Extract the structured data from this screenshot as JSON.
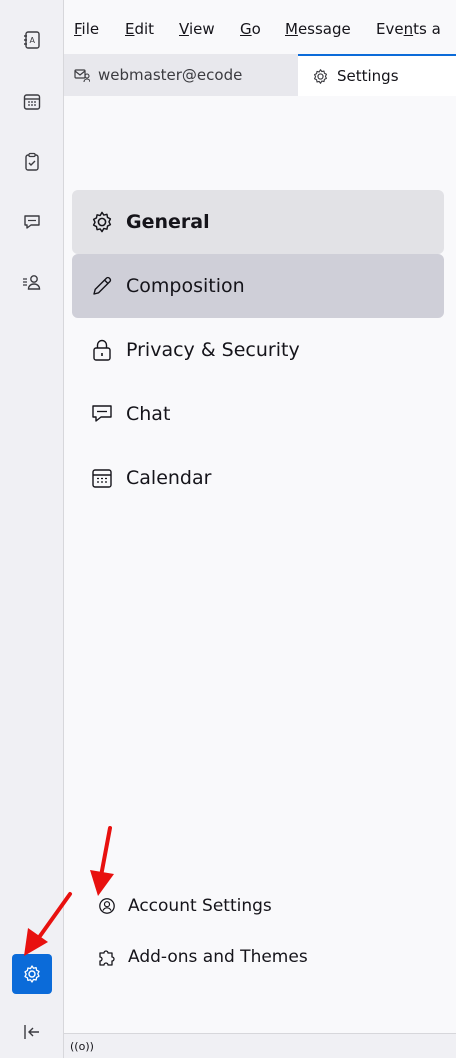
{
  "spaces": {
    "items": [
      {
        "name": "address-book"
      },
      {
        "name": "calendar"
      },
      {
        "name": "tasks"
      },
      {
        "name": "chat"
      },
      {
        "name": "contacts"
      }
    ],
    "settings_active": true
  },
  "menu": [
    "File",
    "Edit",
    "View",
    "Go",
    "Message",
    "Events a"
  ],
  "menu_underline": [
    "F",
    "E",
    "V",
    "G",
    "M",
    "n"
  ],
  "tabs": {
    "inactive_label": "webmaster@ecode",
    "active_label": "Settings"
  },
  "categories": [
    {
      "label": "General",
      "state": "selected"
    },
    {
      "label": "Composition",
      "state": "hovered"
    },
    {
      "label": "Privacy & Security",
      "state": "normal"
    },
    {
      "label": "Chat",
      "state": "normal"
    },
    {
      "label": "Calendar",
      "state": "normal"
    }
  ],
  "footer_links": {
    "account_settings": "Account Settings",
    "addons": "Add-ons and Themes"
  },
  "status": {
    "indicator": "((o))"
  },
  "colors": {
    "accent": "#0b6bd9",
    "annotation_arrow": "#e8110f"
  }
}
